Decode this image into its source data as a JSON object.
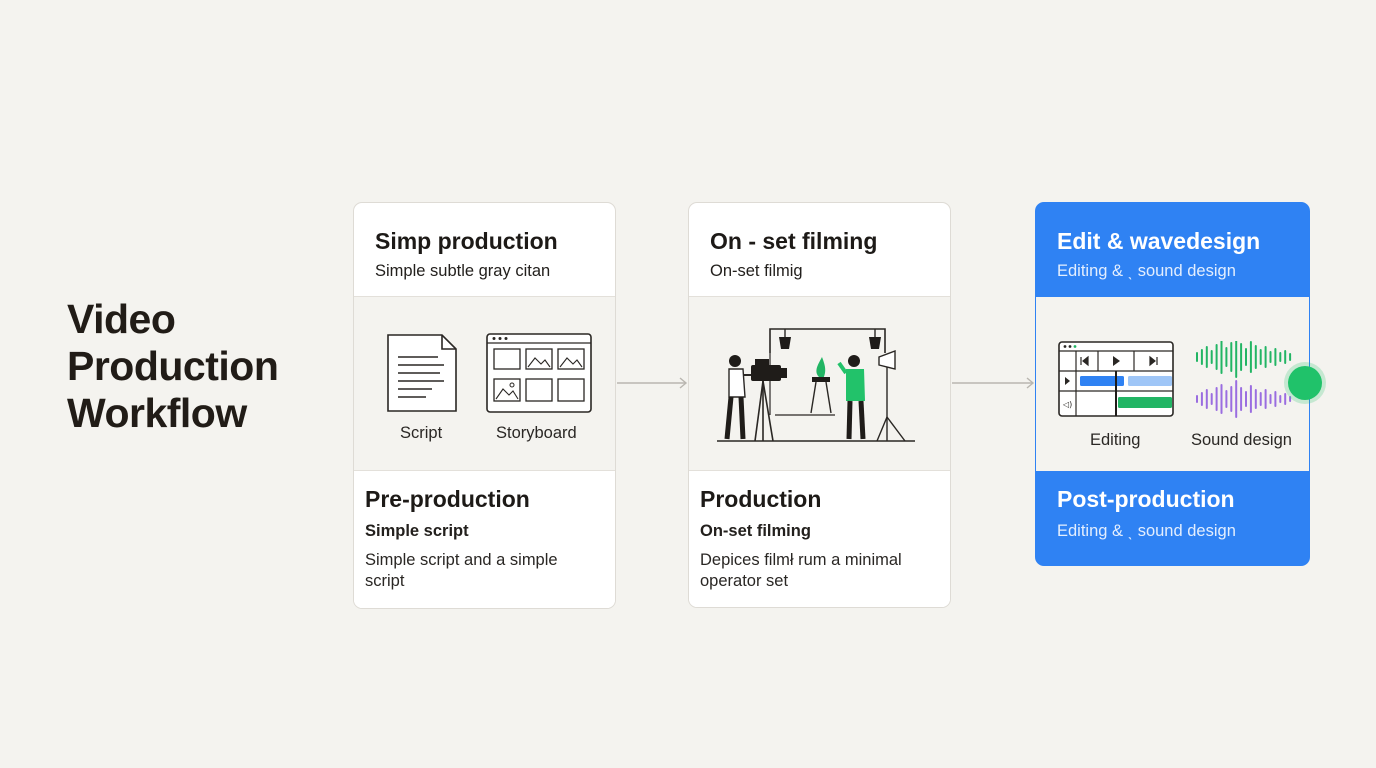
{
  "title": [
    "Video",
    "Production",
    "Workflow"
  ],
  "stages": [
    {
      "header_title": "Simp production",
      "header_subtitle": "Simple subtle gray citan",
      "items": [
        "Script",
        "Storyboard"
      ],
      "footer_title": "Pre-production",
      "footer_subtitle": "Simple script",
      "footer_description": "Simple script and a simple script"
    },
    {
      "header_title": "On - set filming",
      "header_subtitle": "On-set filmig",
      "footer_title": "Production",
      "footer_subtitle": "On-set filming",
      "footer_description": "Depices filmł rum a minimal operator set"
    },
    {
      "header_title": "Edit & wavedesign",
      "header_subtitle": "Editing & ˎ sound design",
      "items": [
        "Editing",
        "Sound design"
      ],
      "footer_title": "Post-production",
      "footer_subtitle": "Editing & ˎ sound design"
    }
  ],
  "colors": {
    "accent_blue": "#2f82f3",
    "accent_green": "#20c26a",
    "wave_purple": "#9a6de0",
    "background": "#f4f3ef"
  },
  "icons": [
    "document-icon",
    "storyboard-icon",
    "film-set-icon",
    "editing-timeline-icon",
    "sound-wave-icon",
    "arrow-right-icon",
    "status-dot-icon"
  ]
}
